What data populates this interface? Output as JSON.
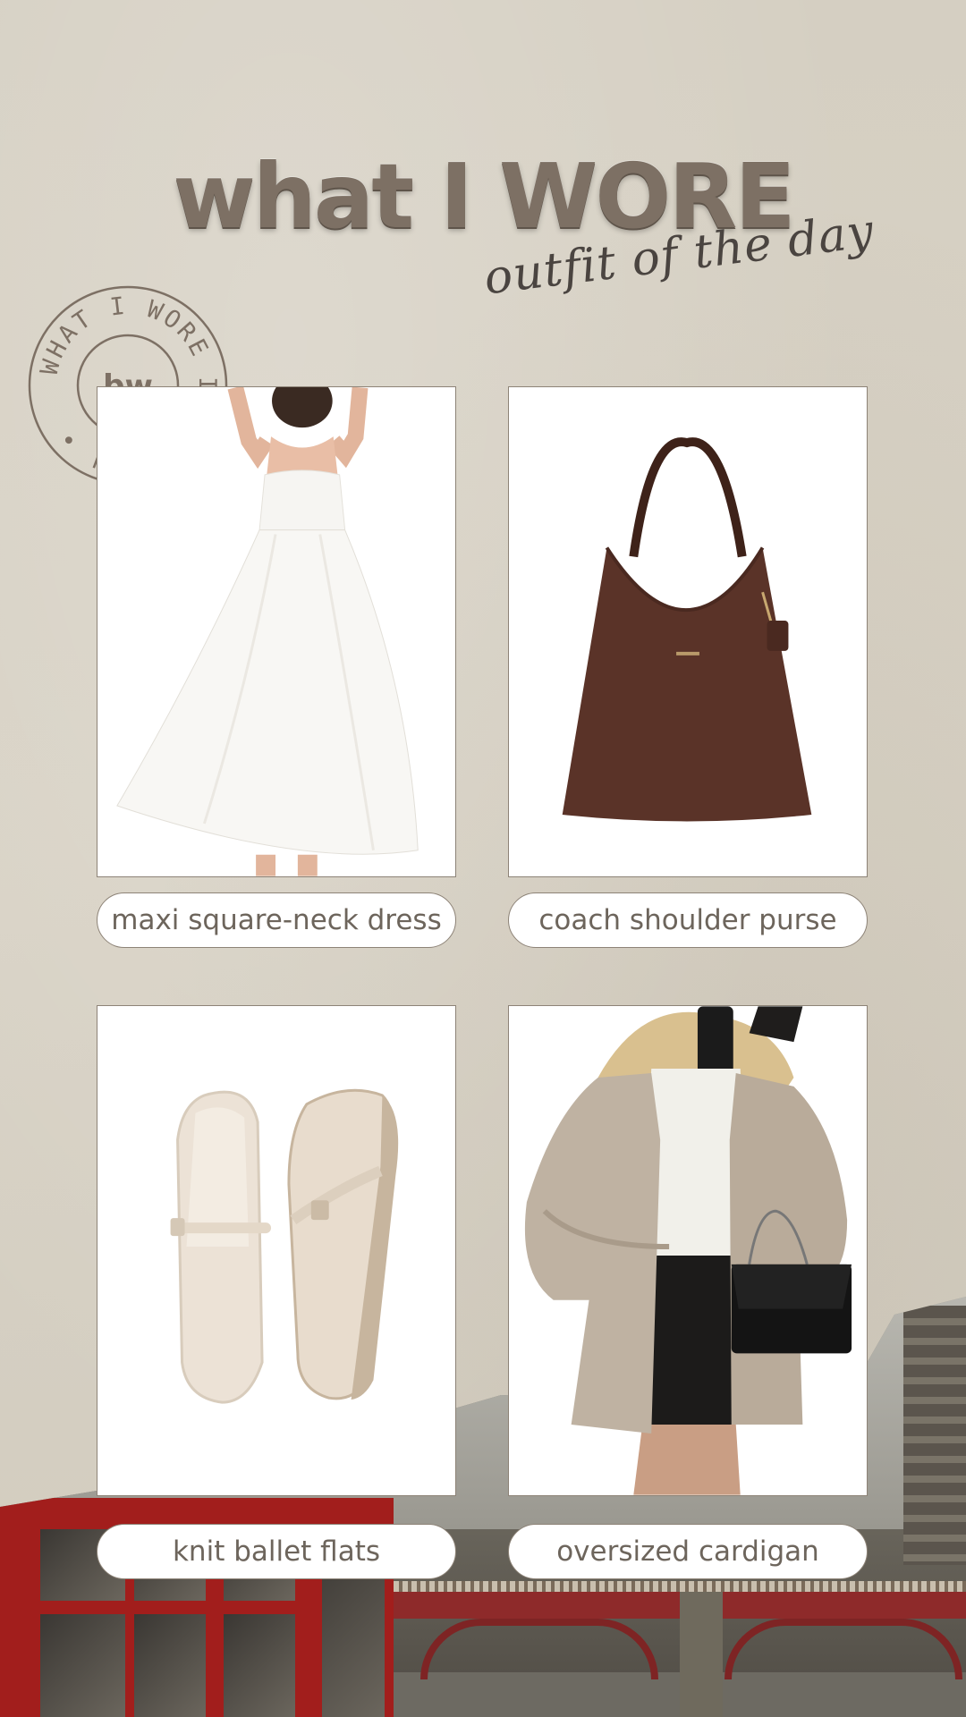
{
  "header": {
    "title": "what I WORE",
    "subtitle": "outfit of the day"
  },
  "stamp": {
    "ring_text": "WHAT I WORE IN LONDON •",
    "logo": "bw"
  },
  "items": [
    {
      "label": "maxi square-neck dress",
      "image": "white-dress-photo"
    },
    {
      "label": "coach shoulder purse",
      "image": "brown-hobo-bag-photo"
    },
    {
      "label": "knit ballet flats",
      "image": "cream-mary-jane-flats-photo"
    },
    {
      "label": "oversized cardigan",
      "image": "beige-cardigan-outfit-photo"
    }
  ],
  "colors": {
    "background": "#d6d0c3",
    "title": "#7d7064",
    "border": "#8d8377",
    "label_text": "#6d655c",
    "bag": "#5a3328"
  }
}
